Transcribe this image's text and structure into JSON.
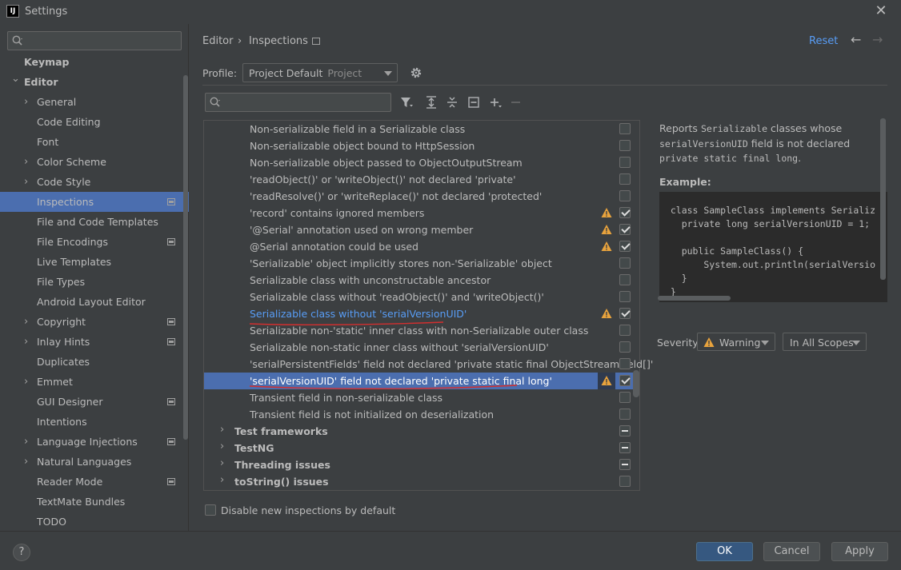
{
  "window": {
    "title": "Settings",
    "app_icon_text": "IJ"
  },
  "left_search": {
    "placeholder": ""
  },
  "sidebar": {
    "items": [
      {
        "label": "Keymap",
        "expand": "none"
      },
      {
        "label": "Editor",
        "expand": "expanded"
      },
      {
        "label": "General",
        "expand": "collapsed"
      },
      {
        "label": "Code Editing",
        "expand": "none"
      },
      {
        "label": "Font",
        "expand": "none"
      },
      {
        "label": "Color Scheme",
        "expand": "collapsed"
      },
      {
        "label": "Code Style",
        "expand": "collapsed"
      },
      {
        "label": "Inspections",
        "expand": "none",
        "selected": true,
        "badge": true
      },
      {
        "label": "File and Code Templates",
        "expand": "none"
      },
      {
        "label": "File Encodings",
        "expand": "none",
        "badge": true
      },
      {
        "label": "Live Templates",
        "expand": "none"
      },
      {
        "label": "File Types",
        "expand": "none"
      },
      {
        "label": "Android Layout Editor",
        "expand": "none"
      },
      {
        "label": "Copyright",
        "expand": "collapsed",
        "badge": true
      },
      {
        "label": "Inlay Hints",
        "expand": "collapsed",
        "badge": true
      },
      {
        "label": "Duplicates",
        "expand": "none"
      },
      {
        "label": "Emmet",
        "expand": "collapsed"
      },
      {
        "label": "GUI Designer",
        "expand": "none",
        "badge": true
      },
      {
        "label": "Intentions",
        "expand": "none"
      },
      {
        "label": "Language Injections",
        "expand": "collapsed",
        "badge": true
      },
      {
        "label": "Natural Languages",
        "expand": "collapsed"
      },
      {
        "label": "Reader Mode",
        "expand": "none",
        "badge": true
      },
      {
        "label": "TextMate Bundles",
        "expand": "none"
      },
      {
        "label": "TODO",
        "expand": "none"
      }
    ]
  },
  "breadcrumb": {
    "parent": "Editor",
    "separator": "›",
    "current": "Inspections"
  },
  "header": {
    "reset": "Reset",
    "back_icon": "arrow-left-icon",
    "forward_icon": "arrow-right-icon"
  },
  "profile": {
    "label": "Profile:",
    "value": "Project Default",
    "scope": "Project"
  },
  "inspection_search": {
    "placeholder": ""
  },
  "inspections": [
    {
      "label": "Non-serializable field in a Serializable class",
      "warn": false,
      "state": "unchecked"
    },
    {
      "label": "Non-serializable object bound to HttpSession",
      "warn": false,
      "state": "unchecked"
    },
    {
      "label": "Non-serializable object passed to ObjectOutputStream",
      "warn": false,
      "state": "unchecked"
    },
    {
      "label": "'readObject()' or 'writeObject()' not declared 'private'",
      "warn": false,
      "state": "unchecked"
    },
    {
      "label": "'readResolve()' or 'writeReplace()' not declared 'protected'",
      "warn": false,
      "state": "unchecked"
    },
    {
      "label": "'record' contains ignored members",
      "warn": true,
      "state": "checked"
    },
    {
      "label": "'@Serial' annotation used on wrong member",
      "warn": true,
      "state": "checked"
    },
    {
      "label": "@Serial annotation could be used",
      "warn": true,
      "state": "checked"
    },
    {
      "label": "'Serializable' object implicitly stores non-'Serializable' object",
      "warn": false,
      "state": "unchecked"
    },
    {
      "label": "Serializable class with unconstructable ancestor",
      "warn": false,
      "state": "unchecked"
    },
    {
      "label": "Serializable class without 'readObject()' and 'writeObject()'",
      "warn": false,
      "state": "unchecked"
    },
    {
      "label": "Serializable class without 'serialVersionUID'",
      "warn": true,
      "state": "checked",
      "link": true
    },
    {
      "label": "Serializable non-'static' inner class with non-Serializable outer class",
      "warn": false,
      "state": "unchecked"
    },
    {
      "label": "Serializable non-static inner class without 'serialVersionUID'",
      "warn": false,
      "state": "unchecked"
    },
    {
      "label": "'serialPersistentFields' field not declared 'private static final ObjectStreamField[]'",
      "warn": false,
      "state": "unchecked"
    },
    {
      "label": "'serialVersionUID' field not declared 'private static final long'",
      "warn": true,
      "state": "checked",
      "selected": true
    },
    {
      "label": "Transient field in non-serializable class",
      "warn": false,
      "state": "unchecked"
    },
    {
      "label": "Transient field is not initialized on deserialization",
      "warn": false,
      "state": "unchecked"
    },
    {
      "label": "Test frameworks",
      "group": true,
      "state": "mixed"
    },
    {
      "label": "TestNG",
      "group": true,
      "state": "mixed"
    },
    {
      "label": "Threading issues",
      "group": true,
      "state": "mixed"
    },
    {
      "label": "toString() issues",
      "group": true,
      "state": "unchecked"
    }
  ],
  "description": {
    "p1": "Reports",
    "p1_code": "Serializable",
    "p1_rest": "classes whose",
    "p2_code": "serialVersionUID",
    "p2_rest": "field is not declared",
    "p3_code": "private static final long",
    "p3_rest": ".",
    "example_label": "Example:",
    "code": [
      "  class SampleClass implements Serializ",
      "    private long serialVersionUID = 1;",
      "",
      "    public SampleClass() {",
      "        System.out.println(serialVersio",
      "    }",
      "  }"
    ]
  },
  "severity": {
    "label": "Severity:",
    "value": "Warning",
    "scope": "In All Scopes"
  },
  "disable_new": {
    "label": "Disable new inspections by default"
  },
  "footer": {
    "help": "?",
    "ok": "OK",
    "cancel": "Cancel",
    "apply": "Apply"
  },
  "colors": {
    "accent": "#4b6eaf",
    "link": "#589df6",
    "warning": "#e8a33d",
    "annotation_red": "#d32f2f"
  }
}
